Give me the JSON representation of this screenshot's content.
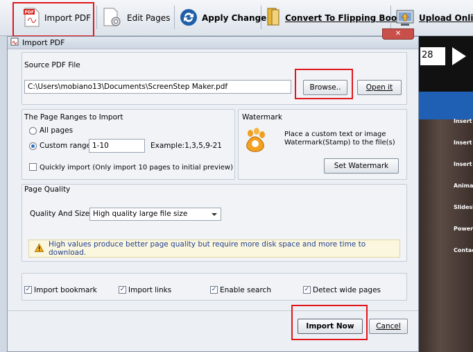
{
  "toolbar": {
    "import_pdf": "Import PDF",
    "edit_pages": "Edit Pages",
    "apply_change": "Apply Change",
    "convert": "Convert To Flipping Book",
    "upload": "Upload Online"
  },
  "dialog": {
    "title": "Import PDF",
    "source": {
      "label": "Source PDF File",
      "path": "C:\\Users\\mobiano13\\Documents\\ScreenStep Maker.pdf",
      "browse": "Browse..",
      "open": "Open it"
    },
    "ranges": {
      "label": "The Page Ranges to Import",
      "all_pages": "All pages",
      "custom_range": "Custom range:",
      "range_value": "1-10",
      "example": "Example:1,3,5,9-21",
      "quick_import": "Quickly import (Only import 10 pages to  initial  preview)"
    },
    "watermark": {
      "label": "Watermark",
      "description_line1": "Place a custom text or image",
      "description_line2": "Watermark(Stamp) to the file(s)",
      "set_button": "Set Watermark"
    },
    "quality": {
      "label": "Page Quality",
      "size_label": "Quality And Size:",
      "selected": "High quality large file size",
      "warning": "High values produce better page quality but require more disk space and more time to download."
    },
    "options": {
      "import_bookmark": "Import bookmark",
      "import_links": "Import links",
      "enable_search": "Enable search",
      "detect_wide": "Detect wide pages"
    },
    "buttons": {
      "import_now": "Import Now",
      "cancel": "Cancel"
    }
  },
  "background": {
    "page_number": "28",
    "side_items": [
      "Insert B",
      "Insert Y",
      "Insert P",
      "Animati",
      "Slidesh",
      "Powerfu",
      "Contact"
    ]
  },
  "colors": {
    "highlight": "#e0161b",
    "accent": "#2f6fc0",
    "warning_bg": "#fbf6de"
  }
}
